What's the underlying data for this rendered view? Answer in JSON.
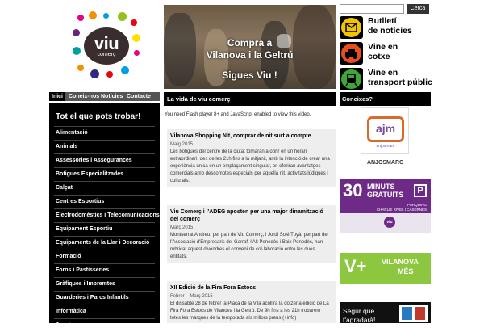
{
  "logo": {
    "word": "viu",
    "sub": "comerç"
  },
  "banner": {
    "line1": "Compra a",
    "line2": "Vilanova i la Geltrú",
    "line3": "Sigues Viu !"
  },
  "search": {
    "placeholder": "",
    "button": "Cerca"
  },
  "promos": [
    {
      "line1": "Butlletí",
      "line2": "de notícies",
      "icon": "envelope-icon",
      "color": "#f2c400"
    },
    {
      "line1": "Vine en",
      "line2": "cotxe",
      "icon": "car-icon",
      "color": "#e84e1b"
    },
    {
      "line1": "Vine en",
      "line2": "transport públic",
      "icon": "train-icon",
      "color": "#3aaa35"
    }
  ],
  "nav": {
    "tabs": [
      "Inici",
      "Coneix-nos",
      "Notícies",
      "Contacte"
    ]
  },
  "sidebar": {
    "title": "Tot el que pots trobar!",
    "items": [
      "Alimentació",
      "Animals",
      "Assessories i Assegurances",
      "Botigues Especialitzades",
      "Calçat",
      "Centres Esportius",
      "Electrodomèstics i Telecomunicacions",
      "Equipament Esportiu",
      "Equipaments de la Llar i Decoració",
      "Formació",
      "Forns i Pastisseries",
      "Gràfiques i Impremtes",
      "Guarderies i Parcs Infantils",
      "Informàtica",
      "Joguines"
    ]
  },
  "main": {
    "heading": "La vida de viu comerç",
    "flash_notice": "You need Flash player 8+ and JavaScript enabled to view this video.",
    "news": [
      {
        "title": "Vilanova Shopping Nit, comprar de nit surt a compte",
        "date": "Maig 2015",
        "body": "Les botigues del centre de la ciutat tornaran a obrir en un horari extraordinari, des de les 21h fins a la mitjanit, amb la intenció de crear una experiència única en un emplaçament singular, on oferiran avantatges comercials amb descomptes especials per aquella nit, activitats lúdiques i culturals."
      },
      {
        "title": "Viu Comerç i l'ADEG aposten per una major dinamització del comerç",
        "date": "Març 2015",
        "body": "Montserrat Andreu, per part de Viu Comerç, i Jordi Solé Tuyà, per part de l'Associació d'Empresaris del Garraf, l'Alt Penedès i Baix Penedès, han rubricat aquest divendres el conveni de col·laboració entre les dues entitats."
      },
      {
        "title": "XII Edició de la Fira Fora Estocs",
        "date": "Febrer – Març 2015",
        "body": "El dissabte 28 de febrer la Plaça de la Vila acollirà la dotzena edició de La Fira Fora Estocs de Vilanova i la Geltrú. De 9h fins a les 21h trobarem totes les marques de la temporada als millors preus (+info)"
      }
    ]
  },
  "right": {
    "heading": "Coneixes?",
    "anjos": {
      "mark": "ajm",
      "sub": "anjosmarc",
      "label": "ANJOSMARC"
    },
    "parking": {
      "big": "30",
      "line1": "MINUTS",
      "line2": "GRATUÏTS",
      "p": "P",
      "place1": "PÀRQUING",
      "place2": "CHARLIE RIVEL I CASERNES",
      "badge": "viu"
    },
    "vplus": {
      "mark": "V+",
      "word1": "VILANOVA",
      "word2": "MÉS"
    },
    "segur": {
      "line1": "Segur que",
      "line2": "t'agradarà!"
    }
  }
}
